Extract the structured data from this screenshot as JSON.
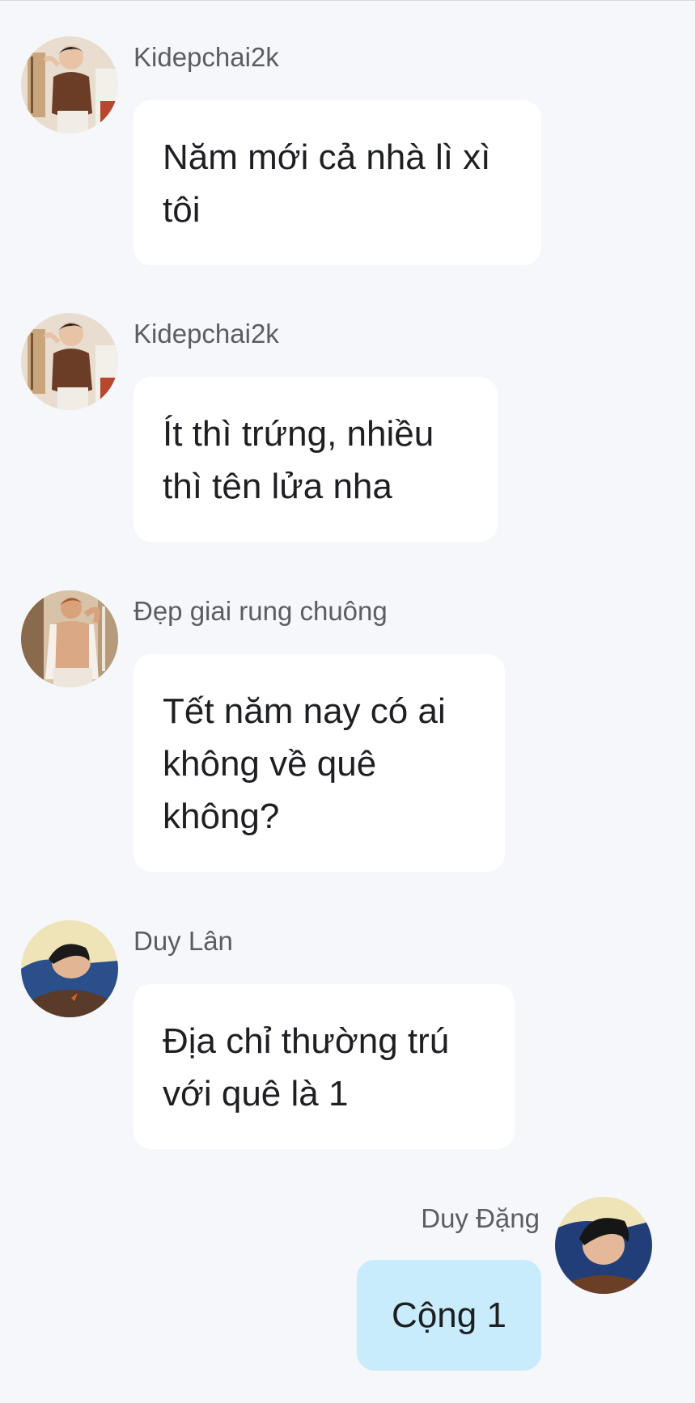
{
  "messages": [
    {
      "sender": "Kidepchai2k",
      "text": "Năm mới cả nhà lì xì tôi",
      "outgoing": false,
      "avatar": "kidepchai2k-avatar"
    },
    {
      "sender": "Kidepchai2k",
      "text": "Ít thì trứng, nhiều thì tên lửa nha",
      "outgoing": false,
      "avatar": "kidepchai2k-avatar"
    },
    {
      "sender": "Đẹp giai rung chuông",
      "text": "Tết năm nay có ai không về quê không?",
      "outgoing": false,
      "avatar": "dep-giai-avatar"
    },
    {
      "sender": "Duy Lân",
      "text": "Địa chỉ thường trú với quê là 1",
      "outgoing": false,
      "avatar": "duy-lan-avatar"
    },
    {
      "sender": "Duy Đặng",
      "text": "Cộng 1",
      "outgoing": true,
      "avatar": "duy-dang-avatar"
    }
  ],
  "colors": {
    "background": "#f5f7fa",
    "incoming_bubble": "#ffffff",
    "outgoing_bubble": "#c8ecfc",
    "sender_name": "#5a5e63",
    "message_text": "#1d1f22"
  }
}
